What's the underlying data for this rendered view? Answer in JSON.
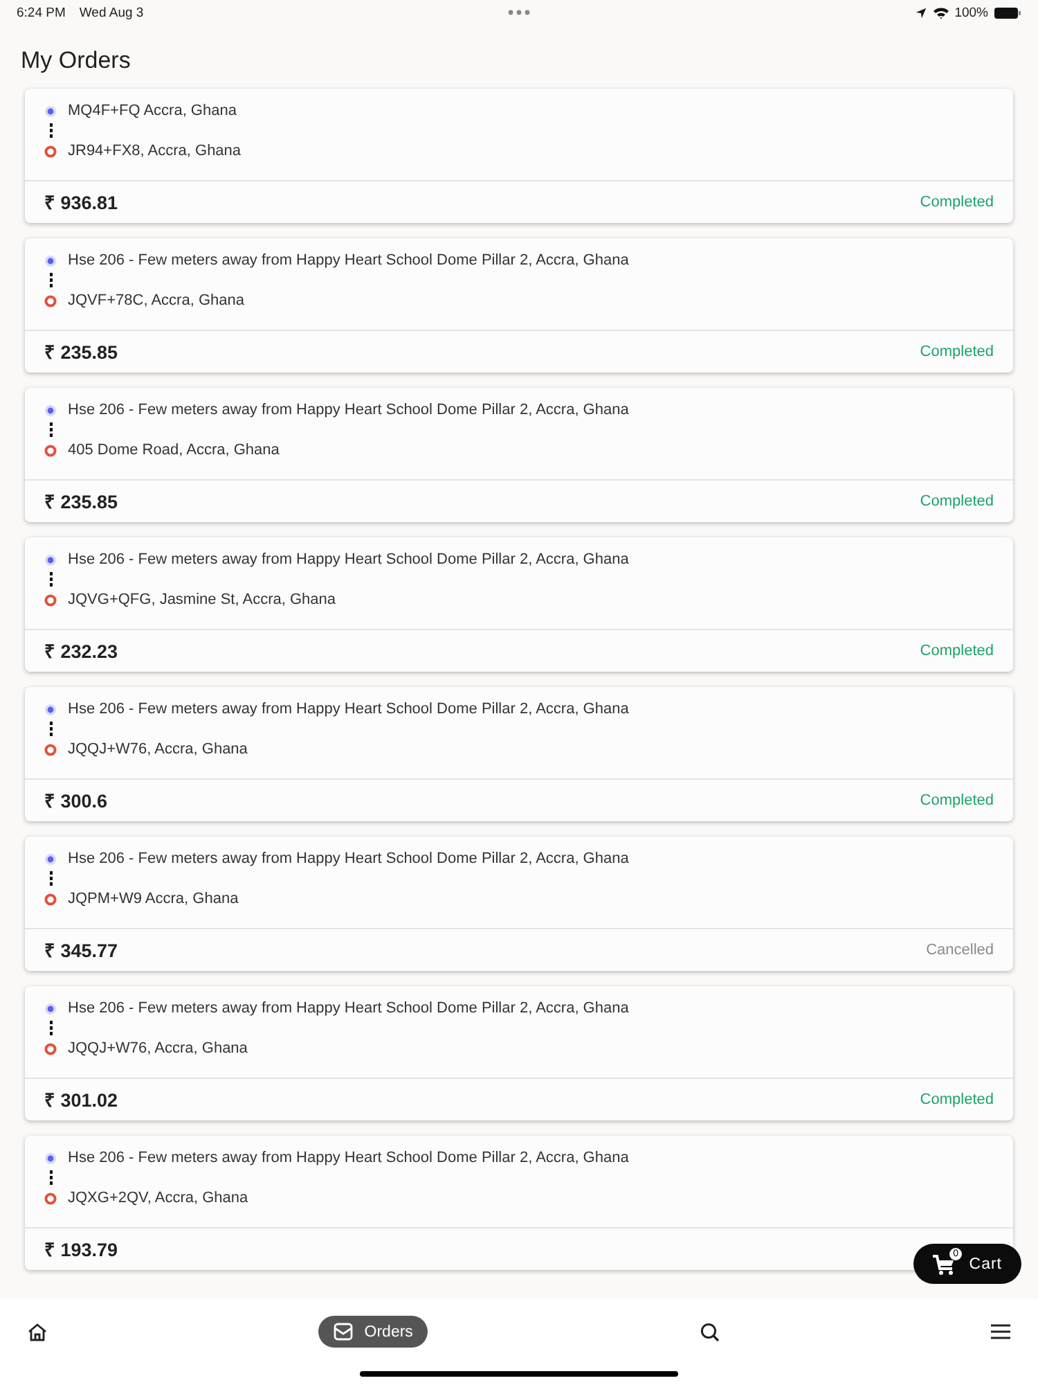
{
  "status_bar": {
    "time": "6:24 PM",
    "date": "Wed Aug 3",
    "battery": "100%"
  },
  "title": "My Orders",
  "orders": [
    {
      "pickup": "MQ4F+FQ Accra, Ghana",
      "dropoff": "JR94+FX8, Accra, Ghana",
      "price": "₹ 936.81",
      "status": "Completed",
      "kind": "completed"
    },
    {
      "pickup": "Hse 206 - Few meters away from Happy Heart School Dome Pillar 2, Accra, Ghana",
      "dropoff": "JQVF+78C, Accra, Ghana",
      "price": "₹ 235.85",
      "status": "Completed",
      "kind": "completed"
    },
    {
      "pickup": "Hse 206 - Few meters away from Happy Heart School Dome Pillar 2, Accra, Ghana",
      "dropoff": "405 Dome Road, Accra, Ghana",
      "price": "₹ 235.85",
      "status": "Completed",
      "kind": "completed"
    },
    {
      "pickup": "Hse 206 - Few meters away from Happy Heart School Dome Pillar 2, Accra, Ghana",
      "dropoff": "JQVG+QFG, Jasmine St, Accra, Ghana",
      "price": "₹ 232.23",
      "status": "Completed",
      "kind": "completed"
    },
    {
      "pickup": "Hse 206 - Few meters away from Happy Heart School Dome Pillar 2, Accra, Ghana",
      "dropoff": "JQQJ+W76, Accra, Ghana",
      "price": "₹ 300.6",
      "status": "Completed",
      "kind": "completed"
    },
    {
      "pickup": "Hse 206 - Few meters away from Happy Heart School Dome Pillar 2, Accra, Ghana",
      "dropoff": "JQPM+W9 Accra, Ghana",
      "price": "₹ 345.77",
      "status": "Cancelled",
      "kind": "cancelled"
    },
    {
      "pickup": "Hse 206 - Few meters away from Happy Heart School Dome Pillar 2, Accra, Ghana",
      "dropoff": "JQQJ+W76, Accra, Ghana",
      "price": "₹ 301.02",
      "status": "Completed",
      "kind": "completed"
    },
    {
      "pickup": "Hse 206 - Few meters away from Happy Heart School Dome Pillar 2, Accra, Ghana",
      "dropoff": "JQXG+2QV, Accra, Ghana",
      "price": "₹ 193.79"
    }
  ],
  "cart": {
    "label": "Cart",
    "count": "0"
  },
  "nav": [
    {
      "kind": "home",
      "selected": false
    },
    {
      "kind": "orders",
      "label": "Orders",
      "selected": true
    },
    {
      "kind": "search",
      "selected": false
    },
    {
      "kind": "menu",
      "selected": false
    }
  ]
}
